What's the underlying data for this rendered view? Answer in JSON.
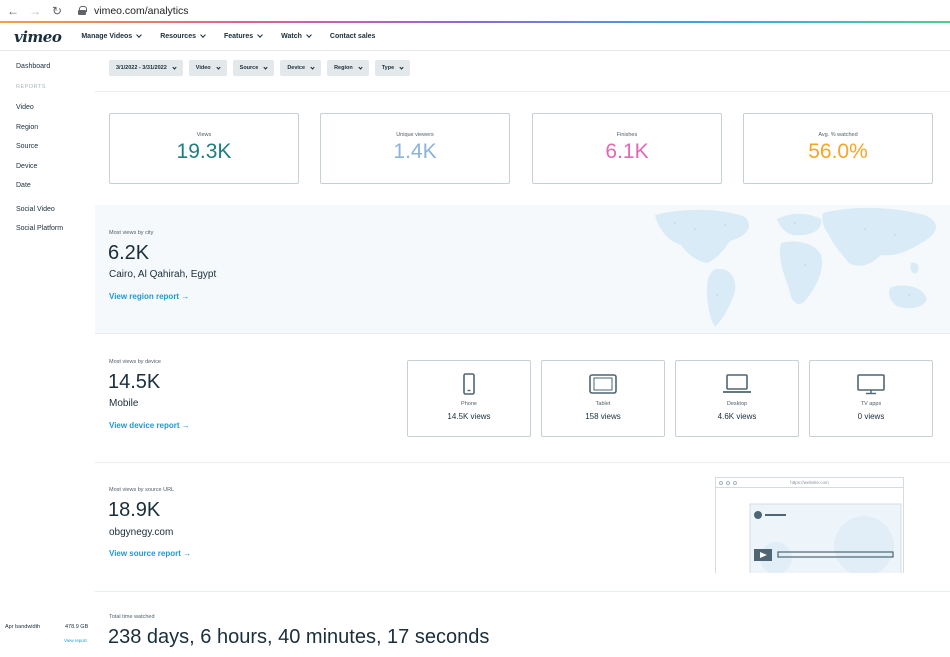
{
  "browser": {
    "url": "vimeo.com/analytics"
  },
  "nav": {
    "logo": "vimeo",
    "items": [
      "Manage Videos",
      "Resources",
      "Features",
      "Watch",
      "Contact sales"
    ]
  },
  "sidebar": {
    "dashboard": "Dashboard",
    "reports_heading": "REPORTS",
    "items": [
      "Video",
      "Region",
      "Source",
      "Device",
      "Date"
    ],
    "social": [
      "Social Video",
      "Social Platform"
    ],
    "bandwidth_label": "Apr bandwidth",
    "bandwidth_value": "478.9 GB",
    "view_report": "View report"
  },
  "filters": [
    "3/1/2022 - 3/31/2022",
    "Video",
    "Source",
    "Device",
    "Region",
    "Type"
  ],
  "stats": [
    {
      "label": "Views",
      "value": "19.3K",
      "color": "#1e7f80"
    },
    {
      "label": "Unique viewers",
      "value": "1.4K",
      "color": "#8ab4dc"
    },
    {
      "label": "Finishes",
      "value": "6.1K",
      "color": "#e06ab4"
    },
    {
      "label": "Avg. % watched",
      "value": "56.0%",
      "color": "#f5a623"
    }
  ],
  "region": {
    "kicker": "Most views by city",
    "value": "6.2K",
    "name": "Cairo, Al Qahirah, Egypt",
    "link": "View region report →"
  },
  "device": {
    "kicker": "Most views by device",
    "value": "14.5K",
    "name": "Mobile",
    "link": "View device report →",
    "cards": [
      {
        "label": "Phone",
        "value": "14.5K views",
        "icon": "phone-icon"
      },
      {
        "label": "Tablet",
        "value": "158 views",
        "icon": "tablet-icon"
      },
      {
        "label": "Desktop",
        "value": "4.6K views",
        "icon": "laptop-icon"
      },
      {
        "label": "TV apps",
        "value": "0 views",
        "icon": "tv-icon"
      }
    ]
  },
  "source": {
    "kicker": "Most views by source URL",
    "value": "18.9K",
    "name": "obgynegy.com",
    "link": "View source report →",
    "mock_url": "https://website.com"
  },
  "time": {
    "kicker": "Total time watched",
    "value": "238 days, 6 hours, 40 minutes, 17 seconds"
  },
  "colors": {
    "link": "#1b9ad6",
    "text": "#1a2e3b"
  }
}
